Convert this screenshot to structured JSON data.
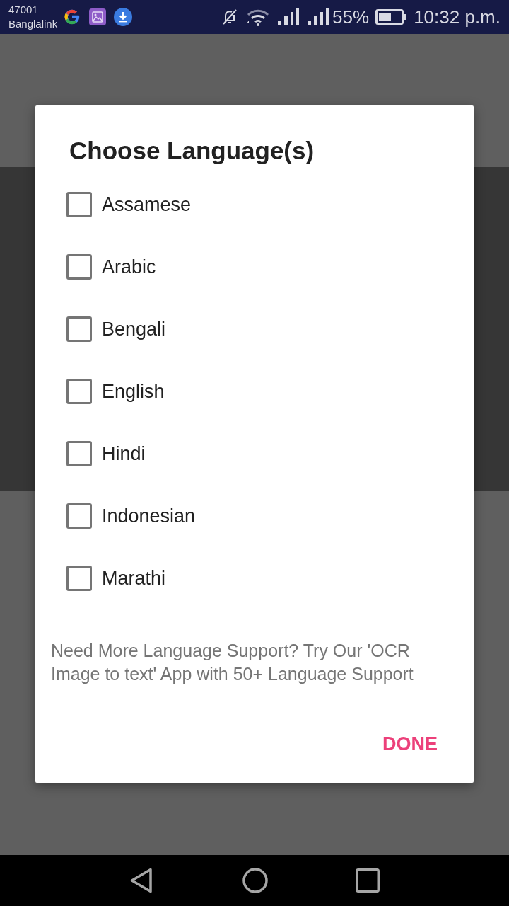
{
  "status_bar": {
    "carrier_code": "47001",
    "carrier": "Banglalink",
    "battery": "55%",
    "time": "10:32 p.m."
  },
  "dialog": {
    "title": "Choose Language(s)",
    "options": [
      {
        "label": "Assamese",
        "checked": false
      },
      {
        "label": "Arabic",
        "checked": false
      },
      {
        "label": "Bengali",
        "checked": false
      },
      {
        "label": "English",
        "checked": false
      },
      {
        "label": "Hindi",
        "checked": false
      },
      {
        "label": "Indonesian",
        "checked": false
      },
      {
        "label": "Marathi",
        "checked": false
      }
    ],
    "note": "Need More Language Support? Try Our 'OCR Image to text' App with 50+ Language Support",
    "button": "DONE"
  }
}
